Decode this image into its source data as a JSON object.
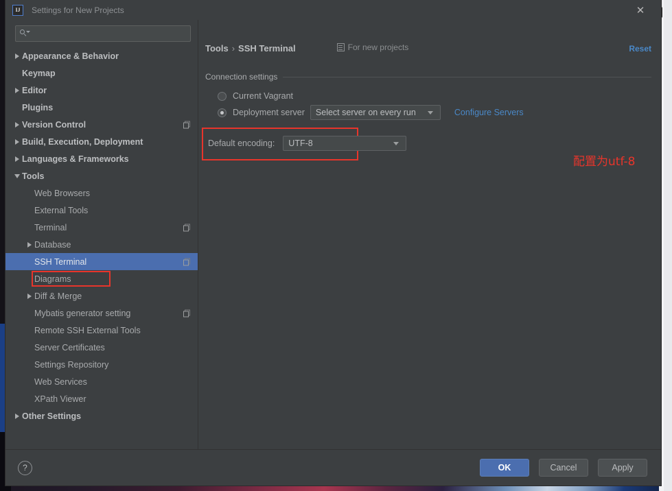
{
  "window": {
    "title": "Settings for New Projects",
    "app_icon": "intellij-idea-logo",
    "close_icon": "close-icon"
  },
  "search": {
    "value": "",
    "placeholder": "",
    "icon": "search-icon"
  },
  "sidebar": {
    "items": [
      {
        "label": "Appearance & Behavior",
        "twisty": "collapsed",
        "indent": 0,
        "bold": true,
        "copy_icon": false,
        "selected": false
      },
      {
        "label": "Keymap",
        "twisty": "none",
        "indent": 0,
        "bold": true,
        "copy_icon": false,
        "selected": false
      },
      {
        "label": "Editor",
        "twisty": "collapsed",
        "indent": 0,
        "bold": true,
        "copy_icon": false,
        "selected": false
      },
      {
        "label": "Plugins",
        "twisty": "none",
        "indent": 0,
        "bold": true,
        "copy_icon": false,
        "selected": false
      },
      {
        "label": "Version Control",
        "twisty": "collapsed",
        "indent": 0,
        "bold": true,
        "copy_icon": true,
        "selected": false
      },
      {
        "label": "Build, Execution, Deployment",
        "twisty": "collapsed",
        "indent": 0,
        "bold": true,
        "copy_icon": false,
        "selected": false
      },
      {
        "label": "Languages & Frameworks",
        "twisty": "collapsed",
        "indent": 0,
        "bold": true,
        "copy_icon": false,
        "selected": false
      },
      {
        "label": "Tools",
        "twisty": "expanded",
        "indent": 0,
        "bold": true,
        "copy_icon": false,
        "selected": false
      },
      {
        "label": "Web Browsers",
        "twisty": "none",
        "indent": 1,
        "bold": false,
        "copy_icon": false,
        "selected": false
      },
      {
        "label": "External Tools",
        "twisty": "none",
        "indent": 1,
        "bold": false,
        "copy_icon": false,
        "selected": false
      },
      {
        "label": "Terminal",
        "twisty": "none",
        "indent": 1,
        "bold": false,
        "copy_icon": true,
        "selected": false
      },
      {
        "label": "Database",
        "twisty": "collapsed",
        "indent": 1,
        "bold": false,
        "copy_icon": false,
        "selected": false
      },
      {
        "label": "SSH Terminal",
        "twisty": "none",
        "indent": 1,
        "bold": false,
        "copy_icon": true,
        "selected": true
      },
      {
        "label": "Diagrams",
        "twisty": "none",
        "indent": 1,
        "bold": false,
        "copy_icon": false,
        "selected": false
      },
      {
        "label": "Diff & Merge",
        "twisty": "collapsed",
        "indent": 1,
        "bold": false,
        "copy_icon": false,
        "selected": false
      },
      {
        "label": "Mybatis generator setting",
        "twisty": "none",
        "indent": 1,
        "bold": false,
        "copy_icon": true,
        "selected": false
      },
      {
        "label": "Remote SSH External Tools",
        "twisty": "none",
        "indent": 1,
        "bold": false,
        "copy_icon": false,
        "selected": false
      },
      {
        "label": "Server Certificates",
        "twisty": "none",
        "indent": 1,
        "bold": false,
        "copy_icon": false,
        "selected": false
      },
      {
        "label": "Settings Repository",
        "twisty": "none",
        "indent": 1,
        "bold": false,
        "copy_icon": false,
        "selected": false
      },
      {
        "label": "Web Services",
        "twisty": "none",
        "indent": 1,
        "bold": false,
        "copy_icon": false,
        "selected": false
      },
      {
        "label": "XPath Viewer",
        "twisty": "none",
        "indent": 1,
        "bold": false,
        "copy_icon": false,
        "selected": false
      },
      {
        "label": "Other Settings",
        "twisty": "collapsed",
        "indent": 0,
        "bold": true,
        "copy_icon": false,
        "selected": false
      }
    ]
  },
  "content": {
    "breadcrumb": {
      "parent": "Tools",
      "separator": "›",
      "current": "SSH Terminal"
    },
    "scope_marker": {
      "label": "For new projects",
      "icon": "scope-document-icon"
    },
    "reset_label": "Reset",
    "group_title": "Connection settings",
    "options": [
      {
        "label": "Current Vagrant",
        "selected": false
      },
      {
        "label": "Deployment server",
        "selected": true
      }
    ],
    "server_combo": {
      "value": "Select server on every run"
    },
    "configure_servers_label": "Configure Servers",
    "encoding_label": "Default encoding:",
    "encoding_combo": {
      "value": "UTF-8"
    },
    "annotation": "配置为utf-8"
  },
  "footer": {
    "help_label": "?",
    "ok_label": "OK",
    "cancel_label": "Cancel",
    "apply_label": "Apply"
  },
  "colors": {
    "window_bg": "#3c3f41",
    "selection_blue": "#4b6eaf",
    "link_blue": "#4a88c7",
    "annotation_red": "#e8352b",
    "text": "#a9abad"
  }
}
